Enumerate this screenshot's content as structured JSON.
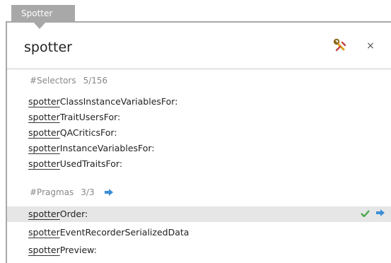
{
  "window": {
    "tab_label": "Spotter"
  },
  "search": {
    "query": "spotter"
  },
  "categories": [
    {
      "name": "#Selectors",
      "count": "5/156"
    },
    {
      "name": "#Pragmas",
      "count": "3/3"
    }
  ],
  "selectors": [
    {
      "match": "spotter",
      "rest": "ClassInstanceVariablesFor:"
    },
    {
      "match": "spotter",
      "rest": "TraitUsersFor:"
    },
    {
      "match": "spotter",
      "rest": "QACriticsFor:"
    },
    {
      "match": "spotter",
      "rest": "InstanceVariablesFor:"
    },
    {
      "match": "spotter",
      "rest": "UsedTraitsFor:"
    }
  ],
  "pragmas": [
    {
      "match": "spotter",
      "rest": "Order:"
    },
    {
      "match": "spotter",
      "rest": "EventRecorderSerializedData"
    },
    {
      "match": "spotter",
      "rest": "Preview:"
    }
  ],
  "icons": {
    "settings": "wrench-icon",
    "close": "close-icon",
    "dive": "arrow-right-icon",
    "check": "checkmark-icon"
  },
  "colors": {
    "accent_blue": "#3c8fd6",
    "check_green": "#4aa84a",
    "tab_gray": "#a8a8a8",
    "selected_row": "#e6e6e6"
  },
  "close_glyph": "×"
}
